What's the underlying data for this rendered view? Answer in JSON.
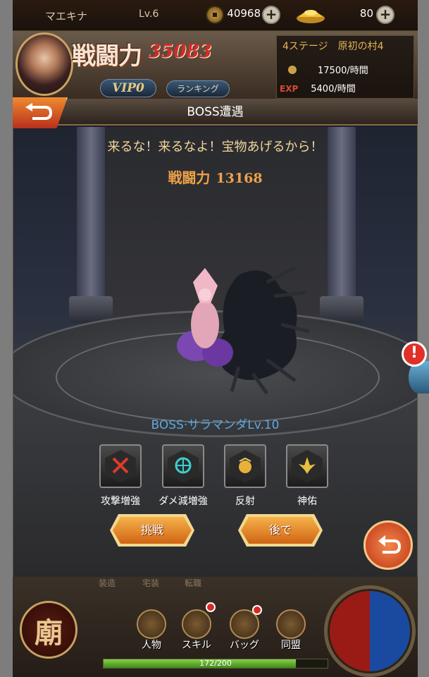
{
  "player": {
    "name": "マエキナ",
    "level": "Lv.6",
    "coins": "40968",
    "gold": "80"
  },
  "power": {
    "label": "戦闘力",
    "value": "35083"
  },
  "buttons": {
    "vip": "VIP0",
    "ranking": "ランキング"
  },
  "stage": {
    "title": "4ステージ　原初の村4",
    "coin_rate": "17500/時間",
    "exp_label": "EXP",
    "exp_rate": "5400/時間"
  },
  "dialog": {
    "title": "BOSS遭遇",
    "tagline": "来るな！来るなよ！宝物あげるから！",
    "power_label": "戦闘力",
    "power_value": "13168",
    "boss_name": "BOSS·サラマンダLv.10",
    "skills": [
      {
        "label": "攻撃増強",
        "icon": "crossed-swords-icon"
      },
      {
        "label": "ダメ減増強",
        "icon": "shield-target-icon"
      },
      {
        "label": "反射",
        "icon": "reflect-orb-icon"
      },
      {
        "label": "神佑",
        "icon": "golden-emblem-icon"
      }
    ],
    "challenge": "挑戦",
    "later": "後で"
  },
  "bottom": {
    "hidden_labels": [
      "装造",
      "宅装",
      "転職"
    ],
    "emblem": "廟",
    "nav": [
      {
        "label": "人物",
        "icon": "character-icon",
        "badge": false
      },
      {
        "label": "スキル",
        "icon": "skill-icon",
        "badge": true
      },
      {
        "label": "バッグ",
        "icon": "bag-icon",
        "badge": true
      },
      {
        "label": "同盟",
        "icon": "alliance-icon",
        "badge": false
      }
    ],
    "exp_text": "172/200",
    "exp_fraction": 0.86
  },
  "alert": "!"
}
